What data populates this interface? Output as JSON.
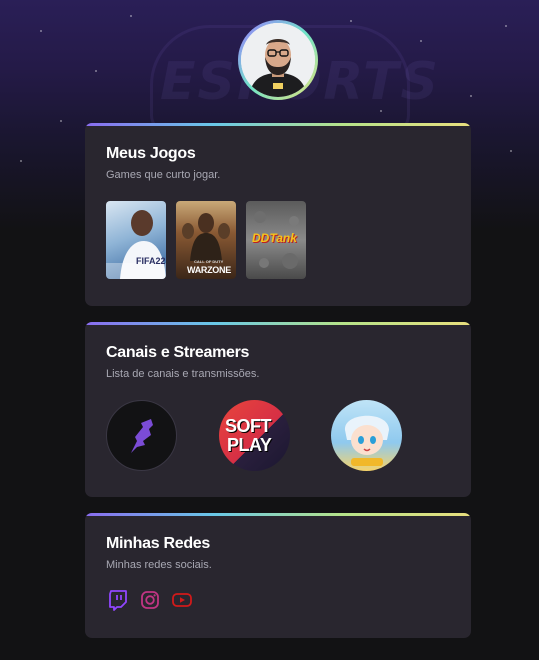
{
  "profile": {
    "avatar_alt": "Foto de perfil"
  },
  "hero": {
    "watermark": "ESPORTS"
  },
  "games_card": {
    "title": "Meus Jogos",
    "subtitle": "Games que curto jogar.",
    "games": [
      {
        "name": "FIFA 22",
        "label": "FIFA22"
      },
      {
        "name": "Call of Duty Warzone",
        "label": "WARZONE",
        "label_top": "CALL OF DUTY"
      },
      {
        "name": "DDTank",
        "label": "DDTank"
      }
    ]
  },
  "streamers_card": {
    "title": "Canais e Streamers",
    "subtitle": "Lista de canais e transmissões.",
    "channels": [
      {
        "name": "canal-1"
      },
      {
        "name": "Soft Play",
        "line1": "SOFT",
        "line2": "PLAY"
      },
      {
        "name": "canal-3"
      }
    ]
  },
  "social_card": {
    "title": "Minhas Redes",
    "subtitle": "Minhas redes sociais.",
    "networks": [
      "twitch-icon",
      "instagram-icon",
      "youtube-icon"
    ]
  },
  "colors": {
    "background": "#121214",
    "card": "#29262f",
    "accent_purple": "#8a6cf0",
    "twitch": "#9146ff",
    "instagram": "#c13584",
    "youtube": "#d21a1a"
  }
}
